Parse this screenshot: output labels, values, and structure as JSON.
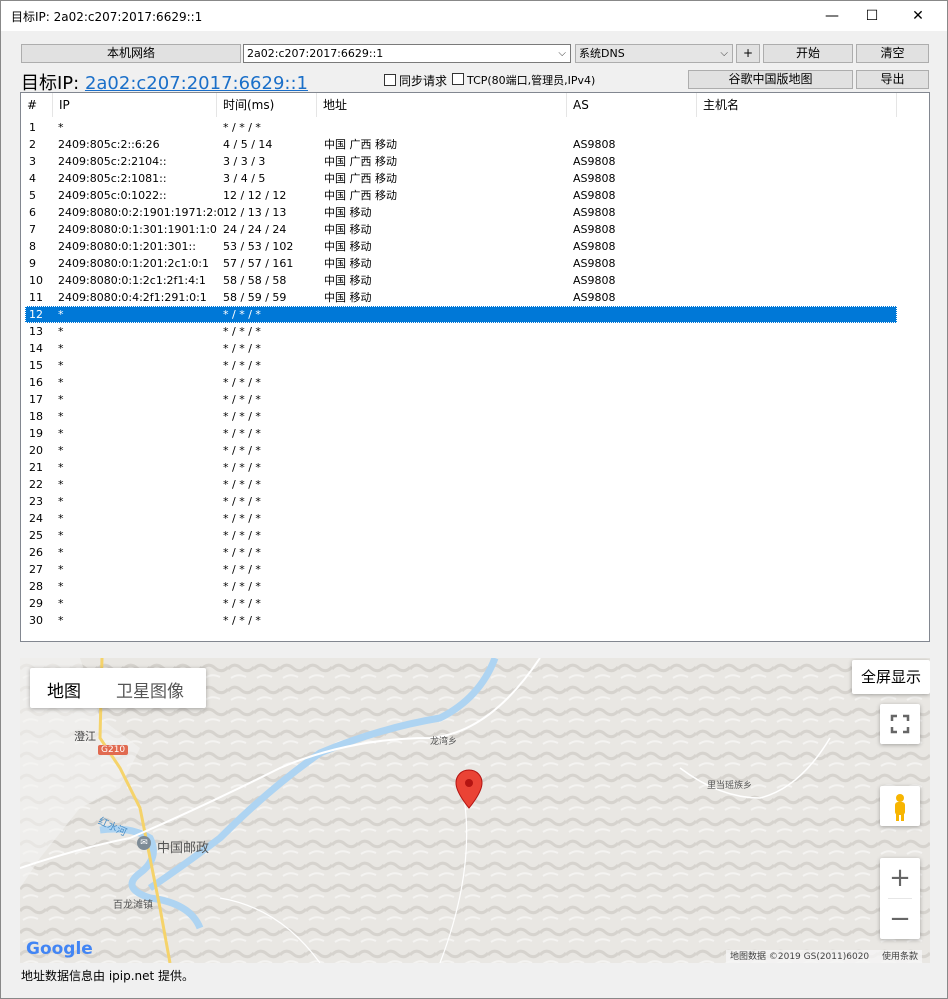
{
  "window": {
    "title": "目标IP: 2a02:c207:2017:6629::1",
    "minimize": "—",
    "maximize": "☐",
    "close": "✕"
  },
  "toolbar": {
    "local_network": "本机网络",
    "ip_value": "2a02:c207:2017:6629::1",
    "dns_value": "系统DNS",
    "plus": "+",
    "start": "开始",
    "clear": "清空",
    "google_map": "谷歌中国版地图",
    "export": "导出",
    "sync_label": "同步请求",
    "tcp_label": "TCP(80端口,管理员,IPv4)"
  },
  "target": {
    "label": "目标IP: ",
    "value": "2a02:c207:2017:6629::1"
  },
  "columns": [
    "#",
    "IP",
    "时间(ms)",
    "地址",
    "AS",
    "主机名"
  ],
  "rows": [
    [
      "1",
      "*",
      "* / * / *",
      "",
      ""
    ],
    [
      "2",
      "2409:805c:2::6:26",
      "4 / 5 / 14",
      "中国 广西 移动",
      "AS9808"
    ],
    [
      "3",
      "2409:805c:2:2104::",
      "3 / 3 / 3",
      "中国 广西 移动",
      "AS9808"
    ],
    [
      "4",
      "2409:805c:2:1081::",
      "3 / 4 / 5",
      "中国 广西 移动",
      "AS9808"
    ],
    [
      "5",
      "2409:805c:0:1022::",
      "12 / 12 / 12",
      "中国 广西 移动",
      "AS9808"
    ],
    [
      "6",
      "2409:8080:0:2:1901:1971:2:0",
      "12 / 13 / 13",
      "中国 移动",
      "AS9808"
    ],
    [
      "7",
      "2409:8080:0:1:301:1901:1:0",
      "24 / 24 / 24",
      "中国 移动",
      "AS9808"
    ],
    [
      "8",
      "2409:8080:0:1:201:301::",
      "53 / 53 / 102",
      "中国 移动",
      "AS9808"
    ],
    [
      "9",
      "2409:8080:0:1:201:2c1:0:1",
      "57 / 57 / 161",
      "中国 移动",
      "AS9808"
    ],
    [
      "10",
      "2409:8080:0:1:2c1:2f1:4:1",
      "58 / 58 / 58",
      "中国 移动",
      "AS9808"
    ],
    [
      "11",
      "2409:8080:0:4:2f1:291:0:1",
      "58 / 59 / 59",
      "中国 移动",
      "AS9808"
    ],
    [
      "12",
      "*",
      "* / * / *",
      "",
      ""
    ],
    [
      "13",
      "*",
      "* / * / *",
      "",
      ""
    ],
    [
      "14",
      "*",
      "* / * / *",
      "",
      ""
    ],
    [
      "15",
      "*",
      "* / * / *",
      "",
      ""
    ],
    [
      "16",
      "*",
      "* / * / *",
      "",
      ""
    ],
    [
      "17",
      "*",
      "* / * / *",
      "",
      ""
    ],
    [
      "18",
      "*",
      "* / * / *",
      "",
      ""
    ],
    [
      "19",
      "*",
      "* / * / *",
      "",
      ""
    ],
    [
      "20",
      "*",
      "* / * / *",
      "",
      ""
    ],
    [
      "21",
      "*",
      "* / * / *",
      "",
      ""
    ],
    [
      "22",
      "*",
      "* / * / *",
      "",
      ""
    ],
    [
      "23",
      "*",
      "* / * / *",
      "",
      ""
    ],
    [
      "24",
      "*",
      "* / * / *",
      "",
      ""
    ],
    [
      "25",
      "*",
      "* / * / *",
      "",
      ""
    ],
    [
      "26",
      "*",
      "* / * / *",
      "",
      ""
    ],
    [
      "27",
      "*",
      "* / * / *",
      "",
      ""
    ],
    [
      "28",
      "*",
      "* / * / *",
      "",
      ""
    ],
    [
      "29",
      "*",
      "* / * / *",
      "",
      ""
    ],
    [
      "30",
      "*",
      "* / * / *",
      "",
      ""
    ]
  ],
  "selected_row": 12,
  "map": {
    "tab_map": "地图",
    "tab_satellite": "卫星图像",
    "fullscreen": "全屏显示",
    "labels": {
      "town1": "澄江",
      "road": "G210",
      "river": "红水河",
      "post": "中国邮政",
      "town2": "百龙滩镇",
      "town3": "龙湾乡",
      "town4": "里当瑶族乡"
    },
    "zoom_in": "+",
    "zoom_out": "−",
    "attribution": "地图数据 ©2019 GS(2011)6020",
    "terms": "使用条款",
    "logo": "Google"
  },
  "footer": "地址数据信息由 ipip.net 提供。",
  "colors": {
    "selection": "#0078d7",
    "link": "#1a6fc9",
    "marker": "#ea4335"
  }
}
